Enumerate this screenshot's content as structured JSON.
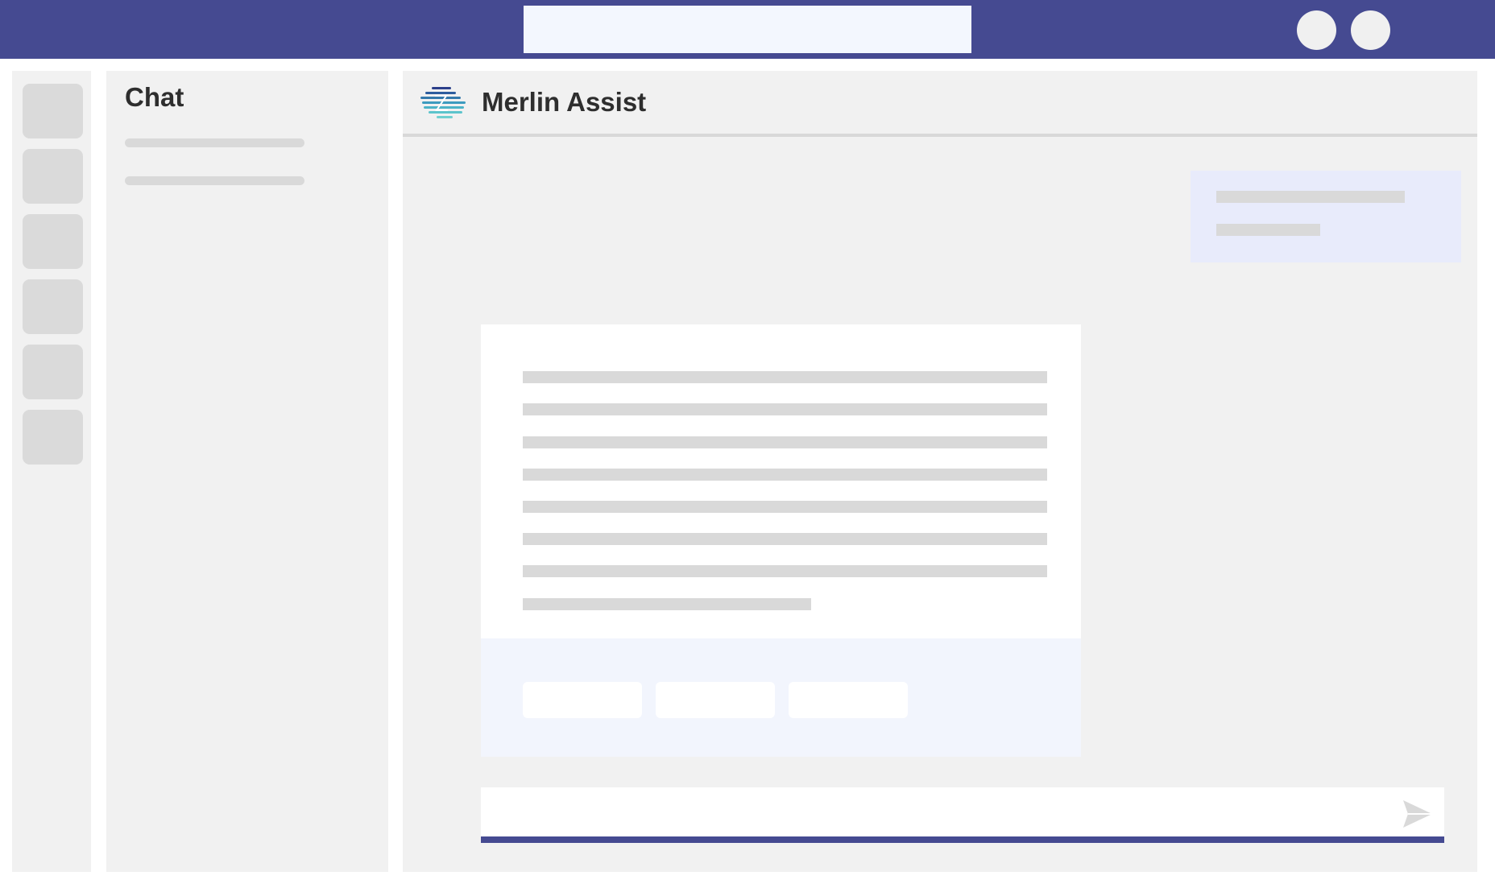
{
  "topbar": {
    "search_value": "",
    "brand_color": "#454a91"
  },
  "chat_list": {
    "title": "Chat"
  },
  "conversation": {
    "bot_name": "Merlin Assist",
    "logo_icon": "merlin-logo-icon"
  },
  "composer": {
    "value": "",
    "send_icon": "send-icon"
  }
}
